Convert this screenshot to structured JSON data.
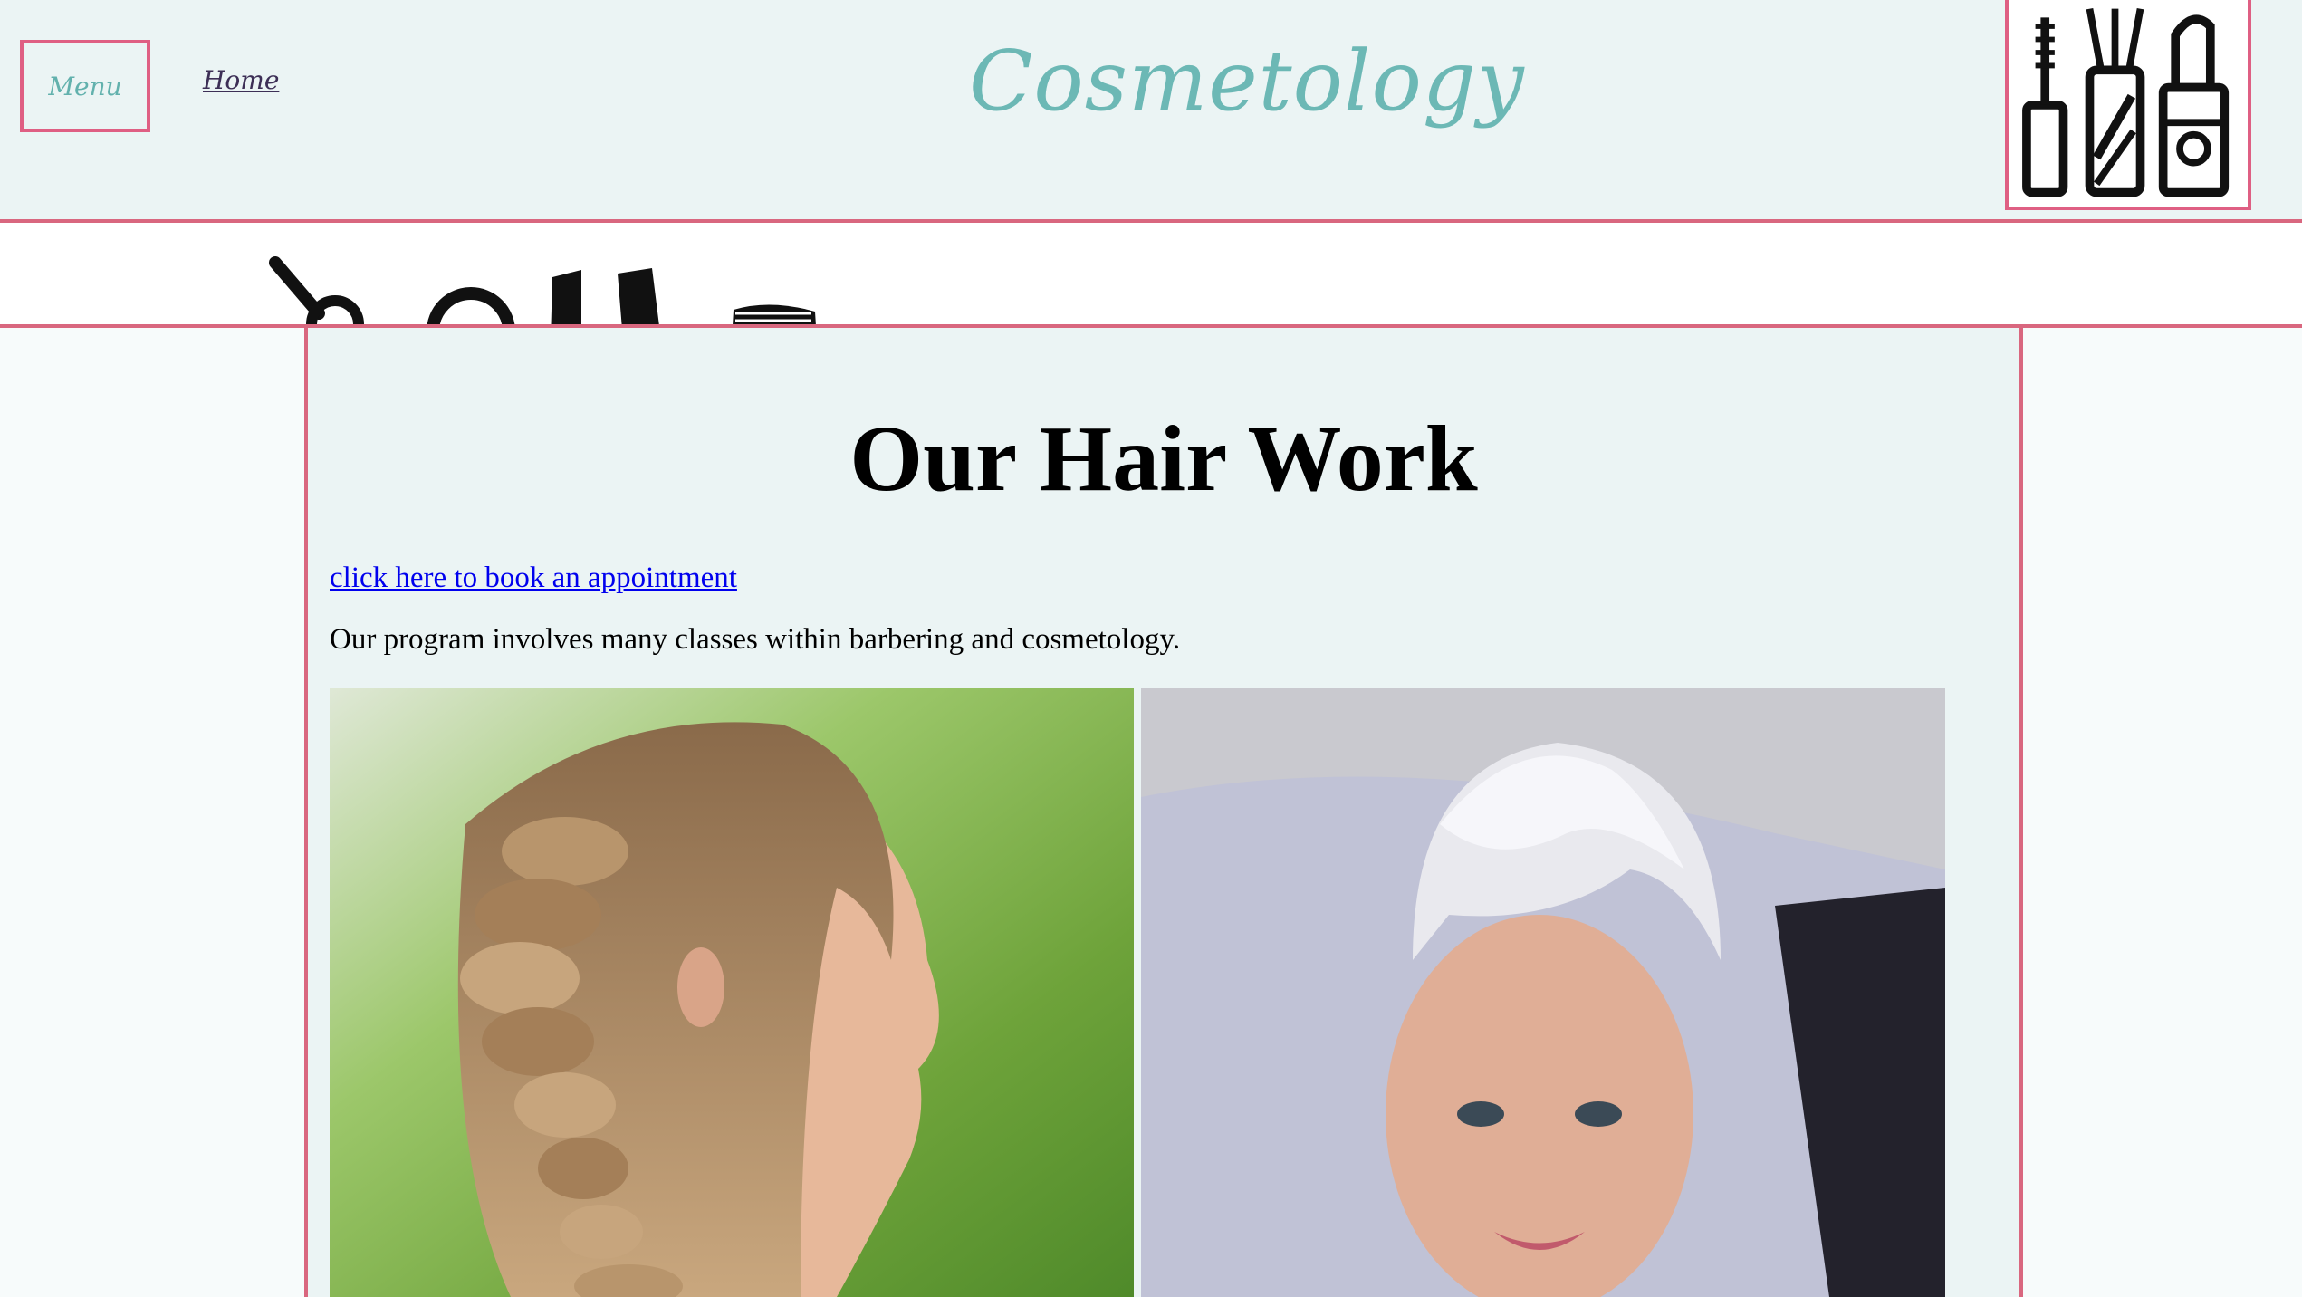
{
  "nav": {
    "menu_label": "Menu",
    "home_label": "Home"
  },
  "brand": {
    "title": "Cosmetology"
  },
  "main": {
    "heading": "Our Hair Work",
    "book_link": "click here to book an appointment",
    "program_text": "Our program involves many classes within barbering and cosmetology."
  },
  "icons": {
    "logo": "makeup-tools-icon",
    "banner": "hair-tools-banner-icons"
  },
  "colors": {
    "accent_pink": "#df5f83",
    "brand_teal": "#6cb8b5",
    "header_bg": "#ebf4f4",
    "link_blue": "#0000ee"
  }
}
